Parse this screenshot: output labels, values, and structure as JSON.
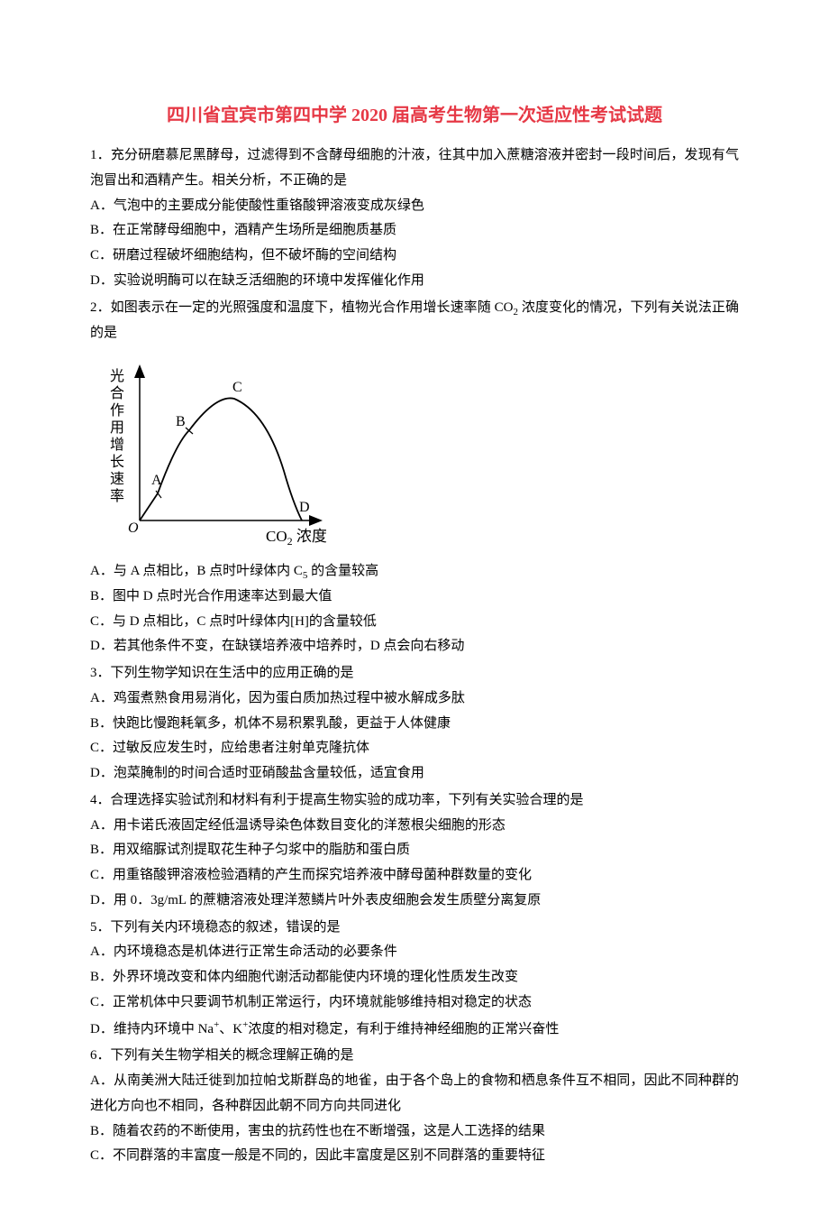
{
  "title": "四川省宜宾市第四中学 2020 届高考生物第一次适应性考试试题",
  "q1": {
    "stem": "1．充分研磨慕尼黑酵母，过滤得到不含酵母细胞的汁液，往其中加入蔗糖溶液并密封一段时间后，发现有气泡冒出和酒精产生。相关分析，不正确的是",
    "A": "A．气泡中的主要成分能使酸性重铬酸钾溶液变成灰绿色",
    "B": "B．在正常酵母细胞中，酒精产生场所是细胞质基质",
    "C": "C．研磨过程破坏细胞结构，但不破坏酶的空间结构",
    "D": "D．实验说明酶可以在缺乏活细胞的环境中发挥催化作用"
  },
  "q2": {
    "stem_prefix": "2．如图表示在一定的光照强度和温度下，植物光合作用增长速率随 CO",
    "stem_suffix": " 浓度变化的情况，下列有关说法正确的是",
    "A_prefix": "A．与 A 点相比，B 点时叶绿体内 C",
    "A_suffix": " 的含量较高",
    "B": "B．图中 D 点时光合作用速率达到最大值",
    "C": "C．与 D 点相比，C 点时叶绿体内[H]的含量较低",
    "D": "D．若其他条件不变，在缺镁培养液中培养时，D 点会向右移动"
  },
  "q3": {
    "stem": "3．下列生物学知识在生活中的应用正确的是",
    "A": "A．鸡蛋煮熟食用易消化，因为蛋白质加热过程中被水解成多肽",
    "B": "B．快跑比慢跑耗氧多，机体不易积累乳酸，更益于人体健康",
    "C": "C．过敏反应发生时，应给患者注射单克隆抗体",
    "D": "D．泡菜腌制的时间合适时亚硝酸盐含量较低，适宜食用"
  },
  "q4": {
    "stem": "4．合理选择实验试剂和材料有利于提高生物实验的成功率，下列有关实验合理的是",
    "A": "A．用卡诺氏液固定经低温诱导染色体数目变化的洋葱根尖细胞的形态",
    "B": "B．用双缩脲试剂提取花生种子匀浆中的脂肪和蛋白质",
    "C": "C．用重铬酸钾溶液检验酒精的产生而探究培养液中酵母菌种群数量的变化",
    "D": "D．用 0．3g/mL 的蔗糖溶液处理洋葱鳞片叶外表皮细胞会发生质壁分离复原"
  },
  "q5": {
    "stem": "5．下列有关内环境稳态的叙述，错误的是",
    "A": "A．内环境稳态是机体进行正常生命活动的必要条件",
    "B": "B．外界环境改变和体内细胞代谢活动都能使内环境的理化性质发生改变",
    "C": "C．正常机体中只要调节机制正常运行，内环境就能够维持相对稳定的状态",
    "D_prefix": "D．维持内环境中 Na",
    "D_mid": "、K",
    "D_suffix": "浓度的相对稳定，有利于维持神经细胞的正常兴奋性"
  },
  "q6": {
    "stem": "6．下列有关生物学相关的概念理解正确的是",
    "A": "A．从南美洲大陆迁徙到加拉帕戈斯群岛的地雀，由于各个岛上的食物和栖息条件互不相同，因此不同种群的进化方向也不相同，各种群因此朝不同方向共同进化",
    "B": "B．随着农药的不断使用，害虫的抗药性也在不断增强，这是人工选择的结果",
    "C": "C．不同群落的丰富度一般是不同的，因此丰富度是区别不同群落的重要特征"
  },
  "chart_data": {
    "type": "line",
    "title": "",
    "xlabel": "CO₂ 浓度",
    "ylabel": "光合作用增长速率",
    "points": [
      {
        "label": "O",
        "x": 0,
        "y": 0
      },
      {
        "label": "A",
        "x": 1,
        "y": 1.5
      },
      {
        "label": "B",
        "x": 2,
        "y": 3.5
      },
      {
        "label": "C",
        "x": 4,
        "y": 5
      },
      {
        "label": "D",
        "x": 7,
        "y": 0
      }
    ],
    "description": "Curve rises from origin through A and B to peak at C, then declines back to x-axis at D"
  }
}
